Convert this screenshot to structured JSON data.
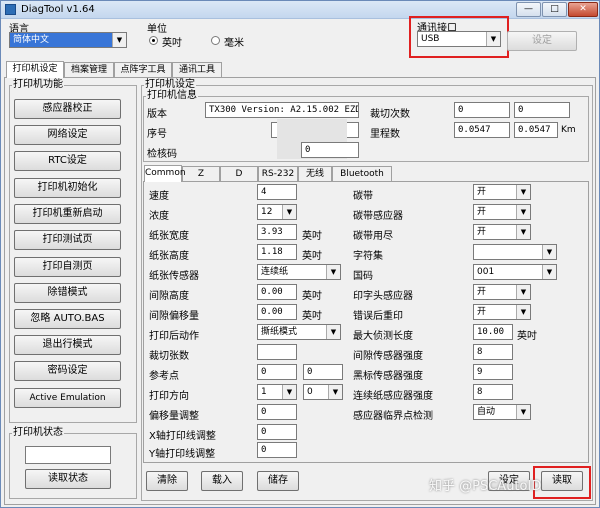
{
  "window": {
    "title": "DiagTool v1.64",
    "min": "—",
    "max": "□",
    "close": "✕"
  },
  "language": {
    "label": "语言",
    "value": "简体中文"
  },
  "unit": {
    "label": "单位",
    "options": [
      "英吋",
      "毫米"
    ],
    "selected": 0
  },
  "comm": {
    "label": "通讯接口",
    "value": "USB",
    "setup": "设定"
  },
  "main_tabs": [
    "打印机设定",
    "档案管理",
    "点阵字工具",
    "通讯工具"
  ],
  "func_group": {
    "title": "打印机功能",
    "buttons": [
      "感应器校正",
      "网络设定",
      "RTC设定",
      "打印机初始化",
      "打印机重新启动",
      "打印测试页",
      "打印自测页",
      "除错模式",
      "忽略 AUTO.BAS",
      "退出行模式",
      "密码设定",
      "Active Emulation"
    ]
  },
  "status_group": {
    "title": "打印机状态",
    "read": "读取状态"
  },
  "settings": {
    "title": "打印机设定"
  },
  "info": {
    "title": "打印机信息",
    "version_label": "版本",
    "version_value": "TX300 Version: A2.15.002 EZD",
    "serial_label": "序号",
    "check_label": "检核码",
    "check_value": "0",
    "cut_label": "裁切次数",
    "cut_v1": "0",
    "cut_v2": "0",
    "mileage_label": "里程数",
    "mileage_v1": "0.0547",
    "mileage_v2": "0.0547",
    "mileage_unit": "Km"
  },
  "sub_tabs": [
    "Common",
    "Z",
    "D",
    "RS-232",
    "无线",
    "Bluetooth"
  ],
  "common": {
    "speed": {
      "label": "速度",
      "value": "4"
    },
    "density": {
      "label": "浓度",
      "value": "12"
    },
    "width": {
      "label": "纸张宽度",
      "value": "3.93",
      "unit": "英吋"
    },
    "height": {
      "label": "纸张高度",
      "value": "1.18",
      "unit": "英吋"
    },
    "sensor": {
      "label": "纸张传感器",
      "value": "连续纸"
    },
    "gap": {
      "label": "间隙高度",
      "value": "0.00",
      "unit": "英吋"
    },
    "gap_offset": {
      "label": "间隙偏移量",
      "value": "0.00",
      "unit": "英吋"
    },
    "post_print": {
      "label": "打印后动作",
      "value": "撕纸模式"
    },
    "cut_count": {
      "label": "裁切张数",
      "value": ""
    },
    "ref": {
      "label": "参考点",
      "v1": "0",
      "v2": "0"
    },
    "direction": {
      "label": "打印方向",
      "v1": "1",
      "v2": "0"
    },
    "offset": {
      "label": "偏移量调整",
      "value": "0"
    },
    "x_adj": {
      "label": "X轴打印线调整",
      "value": "0"
    },
    "y_adj": {
      "label": "Y轴打印线调整",
      "value": "0"
    },
    "ribbon": {
      "label": "碳带",
      "value": "开"
    },
    "ribbon_sensor": {
      "label": "碳带感应器",
      "value": "开"
    },
    "ribbon_end": {
      "label": "碳带用尽",
      "value": "开"
    },
    "charset": {
      "label": "字符集",
      "value": ""
    },
    "codepage": {
      "label": "国码",
      "value": "001"
    },
    "head_sensor": {
      "label": "印字头感应器",
      "value": "开"
    },
    "reprint": {
      "label": "错误后重印",
      "value": "开"
    },
    "max_len": {
      "label": "最大侦测长度",
      "value": "10.00",
      "unit": "英吋"
    },
    "gap_intensity": {
      "label": "间隙传感器强度",
      "value": "8"
    },
    "black_intensity": {
      "label": "黑标传感器强度",
      "value": "9"
    },
    "cont_intensity": {
      "label": "连续纸感应器强度",
      "value": "8"
    },
    "threshold": {
      "label": "感应器临界点检测",
      "value": "自动"
    }
  },
  "bottom": {
    "clear": "清除",
    "load": "载入",
    "save": "储存",
    "set": "设定",
    "read": "读取"
  },
  "watermark": "知乎 @PSCAutoID"
}
